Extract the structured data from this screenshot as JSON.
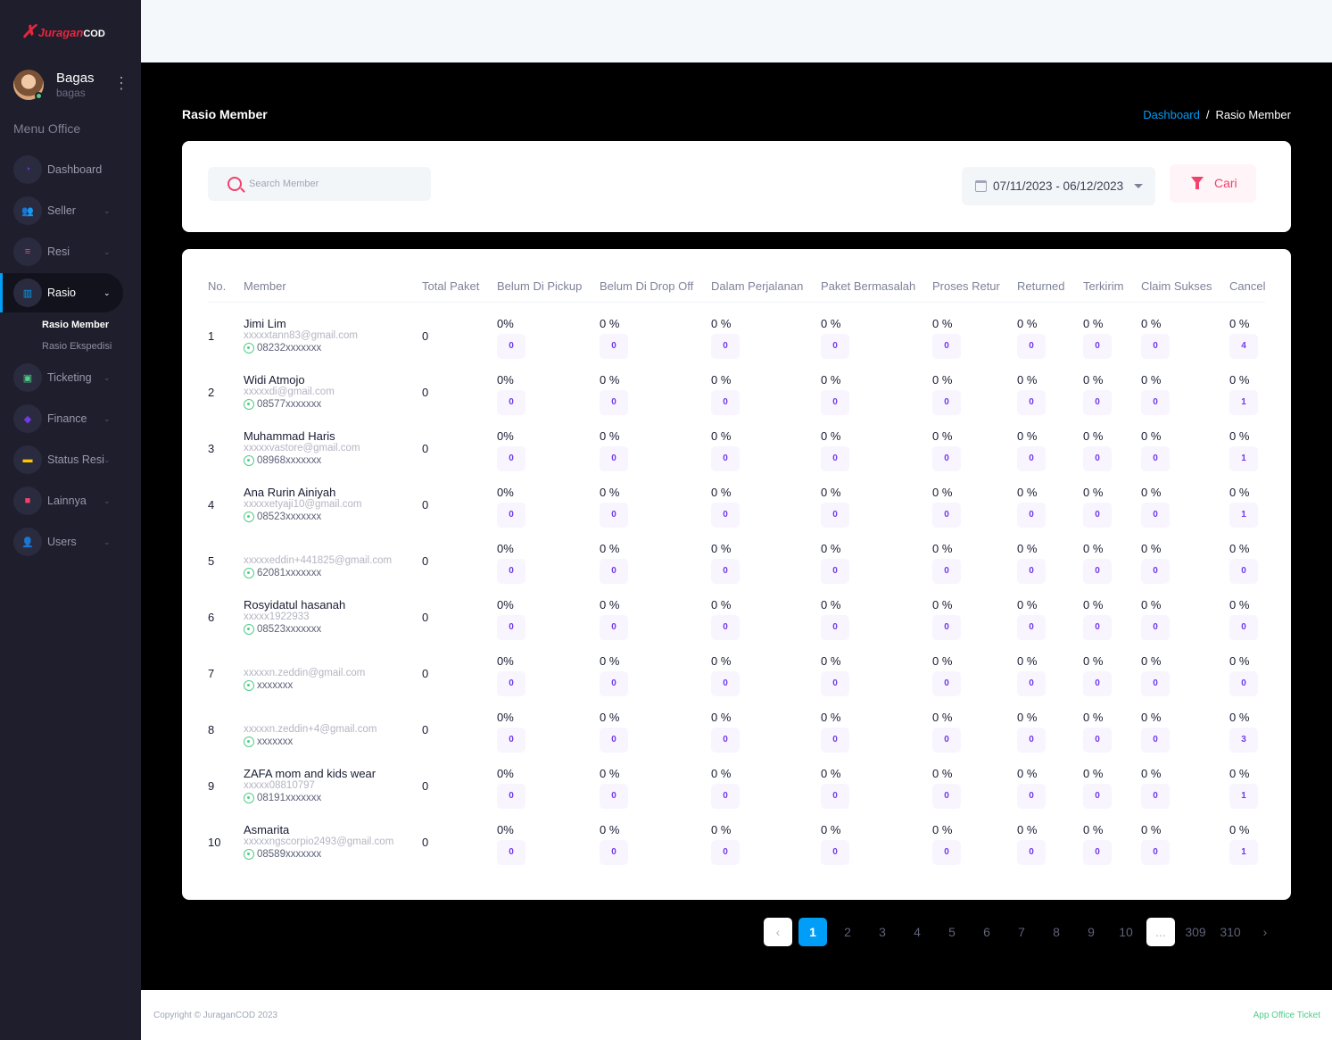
{
  "brand": {
    "mark": "✗",
    "name": "Juragan",
    "suffix": "COD"
  },
  "user": {
    "name": "Bagas",
    "handle": "bagas",
    "menu_icon": "⋮"
  },
  "menu_title": "Menu Office",
  "menu": [
    {
      "label": "Dashboard",
      "icon": "◔",
      "color": "#7239ea",
      "chevron": ""
    },
    {
      "label": "Seller",
      "icon": "👥",
      "color": "#ffc700",
      "chevron": "⌄"
    },
    {
      "label": "Resi",
      "icon": "≡",
      "color": "#f1416c",
      "chevron": "⌄"
    },
    {
      "label": "Rasio",
      "icon": "▥",
      "color": "#009ef7",
      "chevron": "⌄"
    },
    {
      "label": "Ticketing",
      "icon": "▣",
      "color": "#50cd89",
      "chevron": "⌄"
    },
    {
      "label": "Finance",
      "icon": "◆",
      "color": "#7239ea",
      "chevron": "⌄"
    },
    {
      "label": "Status Resi",
      "icon": "▬",
      "color": "#ffc700",
      "chevron": "⌄"
    },
    {
      "label": "Lainnya",
      "icon": "■",
      "color": "#f1416c",
      "chevron": "⌄"
    },
    {
      "label": "Users",
      "icon": "👤",
      "color": "#009ef7",
      "chevron": "⌄"
    }
  ],
  "submenu": [
    {
      "label": "Rasio Member"
    },
    {
      "label": "Rasio Ekspedisi"
    }
  ],
  "page_title": "Rasio Member",
  "breadcrumb": {
    "link": "Dashboard",
    "sep": "/",
    "current": "Rasio Member"
  },
  "filter": {
    "search_placeholder": "Search Member",
    "date_range": "07/11/2023 - 06/12/2023",
    "button_label": "Cari"
  },
  "table": {
    "headers": [
      "No.",
      "Member",
      "Total Paket",
      "Belum Di Pickup",
      "Belum Di Drop Off",
      "Dalam Perjalanan",
      "Paket Bermasalah",
      "Proses Retur",
      "Returned",
      "Terkirim",
      "Claim Sukses",
      "Cancel"
    ],
    "rows": [
      {
        "no": "1",
        "name": "Jimi Lim",
        "email": "xxxxxtann83@gmail.com",
        "phone": "08232xxxxxxx",
        "total": "0",
        "stats": [
          [
            "0%",
            "0"
          ],
          [
            "0 %",
            "0"
          ],
          [
            "0 %",
            "0"
          ],
          [
            "0 %",
            "0"
          ],
          [
            "0 %",
            "0"
          ],
          [
            "0 %",
            "0"
          ],
          [
            "0 %",
            "0"
          ],
          [
            "0 %",
            "0"
          ],
          [
            "0 %",
            "4"
          ]
        ]
      },
      {
        "no": "2",
        "name": "Widi Atmojo",
        "email": "xxxxxdi@gmail.com",
        "phone": "08577xxxxxxx",
        "total": "0",
        "stats": [
          [
            "0%",
            "0"
          ],
          [
            "0 %",
            "0"
          ],
          [
            "0 %",
            "0"
          ],
          [
            "0 %",
            "0"
          ],
          [
            "0 %",
            "0"
          ],
          [
            "0 %",
            "0"
          ],
          [
            "0 %",
            "0"
          ],
          [
            "0 %",
            "0"
          ],
          [
            "0 %",
            "1"
          ]
        ]
      },
      {
        "no": "3",
        "name": "Muhammad Haris",
        "email": "xxxxxvastore@gmail.com",
        "phone": "08968xxxxxxx",
        "total": "0",
        "stats": [
          [
            "0%",
            "0"
          ],
          [
            "0 %",
            "0"
          ],
          [
            "0 %",
            "0"
          ],
          [
            "0 %",
            "0"
          ],
          [
            "0 %",
            "0"
          ],
          [
            "0 %",
            "0"
          ],
          [
            "0 %",
            "0"
          ],
          [
            "0 %",
            "0"
          ],
          [
            "0 %",
            "1"
          ]
        ]
      },
      {
        "no": "4",
        "name": "Ana Rurin Ainiyah",
        "email": "xxxxxetyaji10@gmail.com",
        "phone": "08523xxxxxxx",
        "total": "0",
        "stats": [
          [
            "0%",
            "0"
          ],
          [
            "0 %",
            "0"
          ],
          [
            "0 %",
            "0"
          ],
          [
            "0 %",
            "0"
          ],
          [
            "0 %",
            "0"
          ],
          [
            "0 %",
            "0"
          ],
          [
            "0 %",
            "0"
          ],
          [
            "0 %",
            "0"
          ],
          [
            "0 %",
            "1"
          ]
        ]
      },
      {
        "no": "5",
        "name": "",
        "email": "xxxxxeddin+441825@gmail.com",
        "phone": "62081xxxxxxx",
        "total": "0",
        "stats": [
          [
            "0%",
            "0"
          ],
          [
            "0 %",
            "0"
          ],
          [
            "0 %",
            "0"
          ],
          [
            "0 %",
            "0"
          ],
          [
            "0 %",
            "0"
          ],
          [
            "0 %",
            "0"
          ],
          [
            "0 %",
            "0"
          ],
          [
            "0 %",
            "0"
          ],
          [
            "0 %",
            "0"
          ]
        ]
      },
      {
        "no": "6",
        "name": "Rosyidatul hasanah",
        "email": "xxxxx1922933",
        "phone": "08523xxxxxxx",
        "total": "0",
        "stats": [
          [
            "0%",
            "0"
          ],
          [
            "0 %",
            "0"
          ],
          [
            "0 %",
            "0"
          ],
          [
            "0 %",
            "0"
          ],
          [
            "0 %",
            "0"
          ],
          [
            "0 %",
            "0"
          ],
          [
            "0 %",
            "0"
          ],
          [
            "0 %",
            "0"
          ],
          [
            "0 %",
            "0"
          ]
        ]
      },
      {
        "no": "7",
        "name": "",
        "email": "xxxxxn.zeddin@gmail.com",
        "phone": "xxxxxxx",
        "total": "0",
        "stats": [
          [
            "0%",
            "0"
          ],
          [
            "0 %",
            "0"
          ],
          [
            "0 %",
            "0"
          ],
          [
            "0 %",
            "0"
          ],
          [
            "0 %",
            "0"
          ],
          [
            "0 %",
            "0"
          ],
          [
            "0 %",
            "0"
          ],
          [
            "0 %",
            "0"
          ],
          [
            "0 %",
            "0"
          ]
        ]
      },
      {
        "no": "8",
        "name": "",
        "email": "xxxxxn.zeddin+4@gmail.com",
        "phone": "xxxxxxx",
        "total": "0",
        "stats": [
          [
            "0%",
            "0"
          ],
          [
            "0 %",
            "0"
          ],
          [
            "0 %",
            "0"
          ],
          [
            "0 %",
            "0"
          ],
          [
            "0 %",
            "0"
          ],
          [
            "0 %",
            "0"
          ],
          [
            "0 %",
            "0"
          ],
          [
            "0 %",
            "0"
          ],
          [
            "0 %",
            "3"
          ]
        ]
      },
      {
        "no": "9",
        "name": "ZAFA mom and kids wear",
        "email": "xxxxx08810797",
        "phone": "08191xxxxxxx",
        "total": "0",
        "stats": [
          [
            "0%",
            "0"
          ],
          [
            "0 %",
            "0"
          ],
          [
            "0 %",
            "0"
          ],
          [
            "0 %",
            "0"
          ],
          [
            "0 %",
            "0"
          ],
          [
            "0 %",
            "0"
          ],
          [
            "0 %",
            "0"
          ],
          [
            "0 %",
            "0"
          ],
          [
            "0 %",
            "1"
          ]
        ]
      },
      {
        "no": "10",
        "name": "Asmarita",
        "email": "xxxxxngscorpio2493@gmail.com",
        "phone": "08589xxxxxxx",
        "total": "0",
        "stats": [
          [
            "0%",
            "0"
          ],
          [
            "0 %",
            "0"
          ],
          [
            "0 %",
            "0"
          ],
          [
            "0 %",
            "0"
          ],
          [
            "0 %",
            "0"
          ],
          [
            "0 %",
            "0"
          ],
          [
            "0 %",
            "0"
          ],
          [
            "0 %",
            "0"
          ],
          [
            "0 %",
            "1"
          ]
        ]
      }
    ]
  },
  "pagination": [
    "‹",
    "1",
    "2",
    "3",
    "4",
    "5",
    "6",
    "7",
    "8",
    "9",
    "10",
    "...",
    "309",
    "310",
    "›"
  ],
  "footer": {
    "copyright": "Copyright © JuraganCOD 2023",
    "link": "App Office Ticket"
  }
}
